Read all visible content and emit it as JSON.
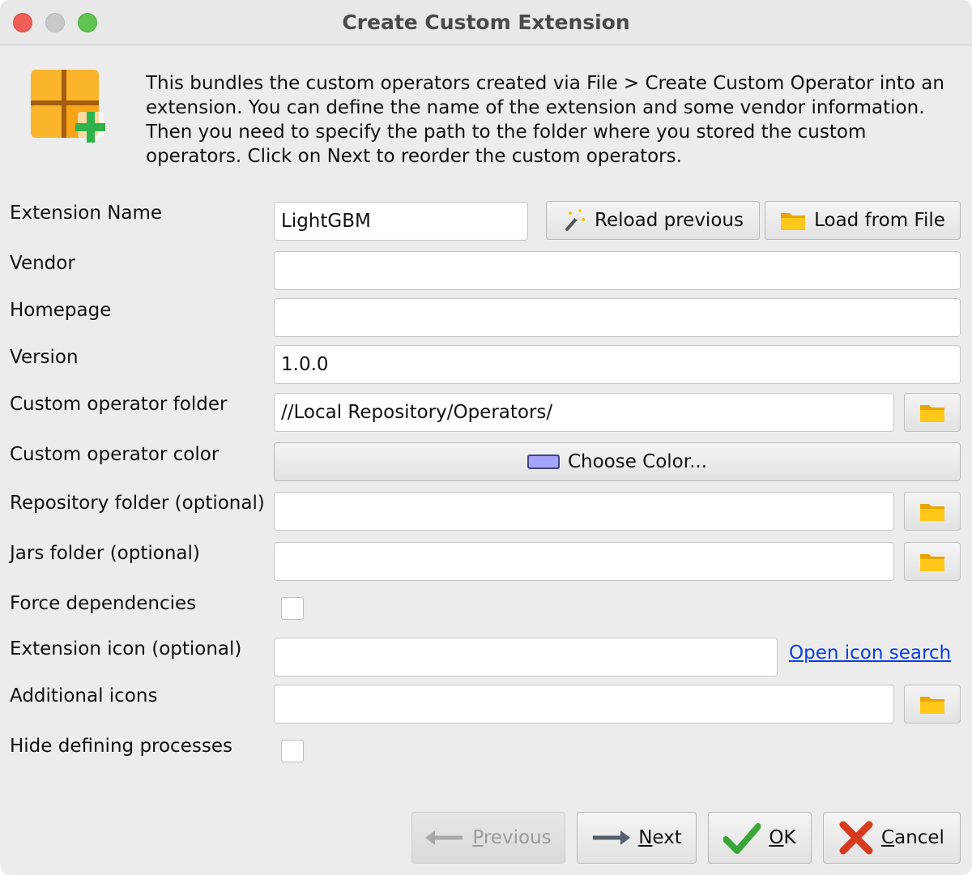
{
  "window": {
    "title": "Create Custom Extension"
  },
  "header": {
    "description": "This bundles the custom operators created via File > Create Custom Operator into an extension. You can define the name of the extension and some vendor information. Then you need to specify the path to the folder where you stored the custom operators. Click on Next to reorder the custom operators.",
    "logo_icon": "grid-plus-icon"
  },
  "form": {
    "extension_name": {
      "label": "Extension Name",
      "value": "LightGBM"
    },
    "reload_previous_label": "Reload previous",
    "load_from_file_label": "Load from File",
    "vendor": {
      "label": "Vendor",
      "value": ""
    },
    "homepage": {
      "label": "Homepage",
      "value": ""
    },
    "version": {
      "label": "Version",
      "value": "1.0.0"
    },
    "custom_operator_folder": {
      "label": "Custom operator folder",
      "value": "//Local Repository/Operators/"
    },
    "custom_operator_color": {
      "label": "Custom operator color",
      "button_label": "Choose Color...",
      "color": "#a3a4ff"
    },
    "repository_folder": {
      "label": "Repository folder (optional)",
      "value": ""
    },
    "jars_folder": {
      "label": "Jars folder (optional)",
      "value": ""
    },
    "force_dependencies": {
      "label": "Force dependencies",
      "checked": false
    },
    "extension_icon": {
      "label": "Extension icon (optional)",
      "value": "",
      "link_label": "Open icon search"
    },
    "additional_icons": {
      "label": "Additional icons",
      "value": ""
    },
    "hide_defining_processes": {
      "label": "Hide defining processes",
      "checked": false
    }
  },
  "footer": {
    "previous": {
      "mnemonic": "P",
      "rest": "revious",
      "enabled": false
    },
    "next": {
      "mnemonic": "N",
      "rest": "ext"
    },
    "ok": {
      "mnemonic": "O",
      "rest": "K"
    },
    "cancel": {
      "mnemonic": "C",
      "rest": "ancel"
    }
  },
  "colors": {
    "accent_link": "#0a3fe0",
    "folder_icon": "#f5b800",
    "ok_check": "#3aa63a",
    "cancel_x": "#d83a1f"
  }
}
